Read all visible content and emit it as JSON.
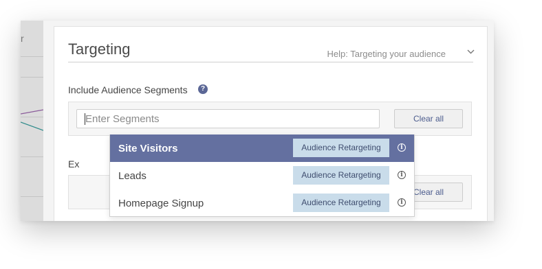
{
  "background": {
    "strip_text": "r"
  },
  "card": {
    "title": "Targeting",
    "help_link": "Help: Targeting your audience"
  },
  "include": {
    "label": "Include Audience Segments",
    "help_icon": "?",
    "input_placeholder": "Enter Segments",
    "clear_label": "Clear all"
  },
  "exclude": {
    "label_visible": "Ex",
    "clear_label": "Clear all"
  },
  "dropdown": {
    "items": [
      {
        "name": "Site Visitors",
        "tag": "Audience Retargeting",
        "info": "i",
        "highlighted": true
      },
      {
        "name": "Leads",
        "tag": "Audience Retargeting",
        "info": "i",
        "highlighted": false
      },
      {
        "name": "Homepage Signup",
        "tag": "Audience Retargeting",
        "info": "i",
        "highlighted": false
      }
    ]
  },
  "colors": {
    "highlight": "#6470a0",
    "tag_bg": "#c9dcea",
    "link_text": "#4a5a8c"
  },
  "icons": [
    "help-circle-icon",
    "chevron-down-icon",
    "info-icon"
  ]
}
